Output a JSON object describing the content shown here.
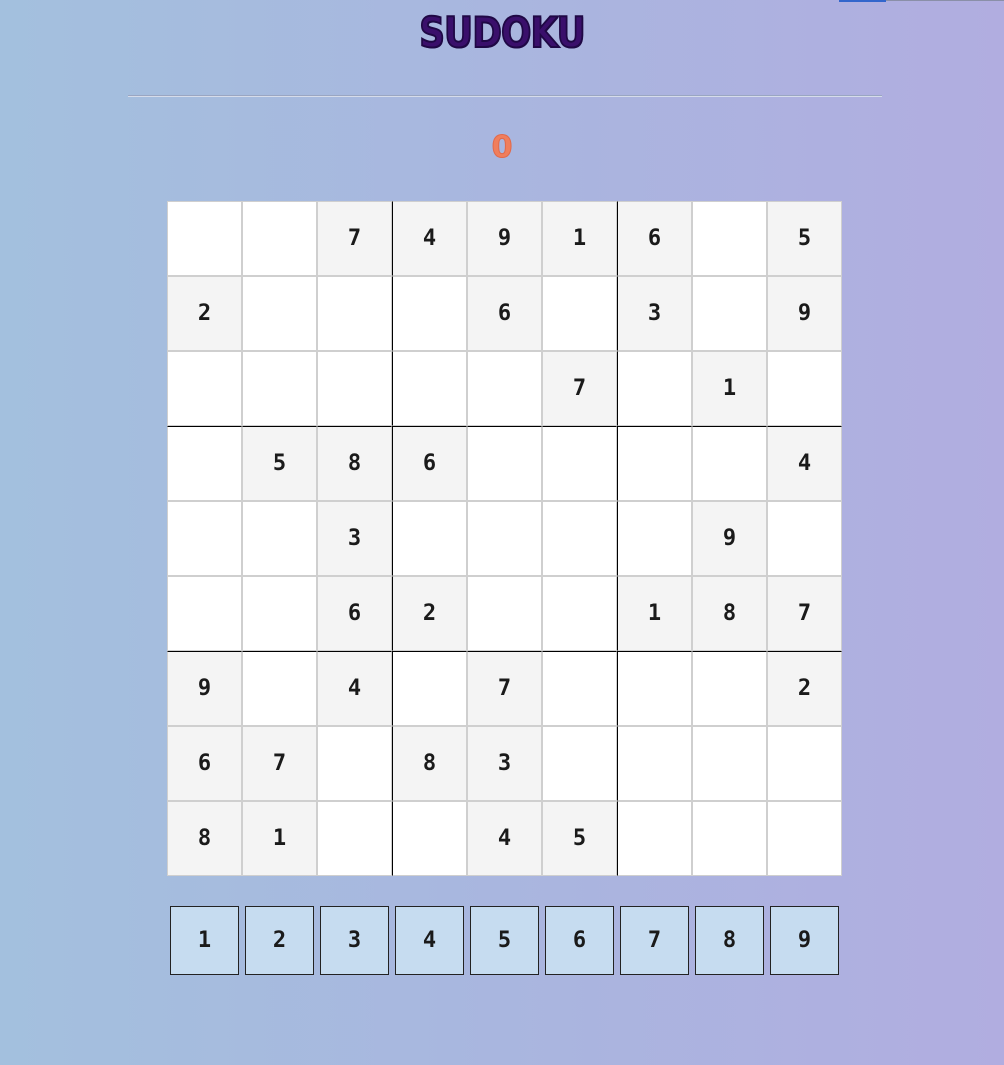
{
  "title": "SUDOKU",
  "score": "0",
  "colors": {
    "title": "#3a0f6b",
    "score": "#f07e5c",
    "given_cell_bg": "#f4f4f4",
    "empty_cell_bg": "#ffffff",
    "numpad_bg": "#c6dcf0"
  },
  "board": [
    [
      "",
      "",
      "7",
      "4",
      "9",
      "1",
      "6",
      "",
      "5"
    ],
    [
      "2",
      "",
      "",
      "",
      "6",
      "",
      "3",
      "",
      "9"
    ],
    [
      "",
      "",
      "",
      "",
      "",
      "7",
      "",
      "1",
      ""
    ],
    [
      "",
      "5",
      "8",
      "6",
      "",
      "",
      "",
      "",
      "4"
    ],
    [
      "",
      "",
      "3",
      "",
      "",
      "",
      "",
      "9",
      ""
    ],
    [
      "",
      "",
      "6",
      "2",
      "",
      "",
      "1",
      "8",
      "7"
    ],
    [
      "9",
      "",
      "4",
      "",
      "7",
      "",
      "",
      "",
      "2"
    ],
    [
      "6",
      "7",
      "",
      "8",
      "3",
      "",
      "",
      "",
      ""
    ],
    [
      "8",
      "1",
      "",
      "",
      "4",
      "5",
      "",
      "",
      ""
    ]
  ],
  "numpad": [
    "1",
    "2",
    "3",
    "4",
    "5",
    "6",
    "7",
    "8",
    "9"
  ]
}
